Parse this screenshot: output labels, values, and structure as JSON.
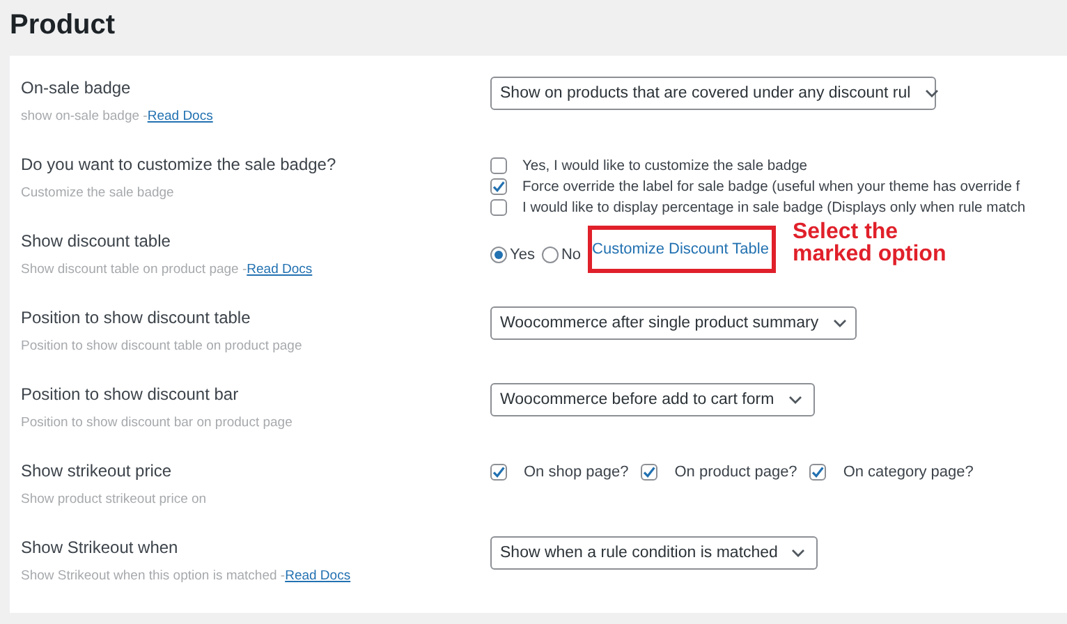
{
  "page": {
    "title": "Product"
  },
  "settings": [
    {
      "label": "On-sale badge",
      "description": "show on-sale badge - ",
      "doc_link": "Read Docs",
      "kind": "select",
      "value": "Show on products that are covered under any discount rul"
    },
    {
      "label": "Do you want to customize the sale badge?",
      "description": "Customize the sale badge",
      "kind": "checklist",
      "options": [
        {
          "label": "Yes, I would like to customize the sale badge",
          "checked": false
        },
        {
          "label": "Force override the label for sale badge (useful when your theme has override f",
          "checked": true
        },
        {
          "label": "I would like to display percentage in sale badge (Displays only when rule match",
          "checked": false
        }
      ]
    },
    {
      "label": "Show discount table",
      "description": "Show discount table on product page - ",
      "doc_link": "Read Docs",
      "kind": "radio",
      "options": [
        {
          "label": "Yes",
          "selected": true
        },
        {
          "label": "No",
          "selected": false
        }
      ],
      "link": "Customize Discount Table",
      "highlighted": true,
      "annotation": "Select the marked option"
    },
    {
      "label": "Position to show discount table",
      "description": "Position to show discount table on product page",
      "kind": "select",
      "value": "Woocommerce after single product summary"
    },
    {
      "label": "Position to show discount bar",
      "description": "Position to show discount bar on product page",
      "kind": "select",
      "value": "Woocommerce before add to cart form"
    },
    {
      "label": "Show strikeout price",
      "description": "Show product strikeout price on",
      "kind": "inline-checks",
      "options": [
        {
          "label": "On shop page?",
          "checked": true
        },
        {
          "label": "On product page?",
          "checked": true
        },
        {
          "label": "On category page?",
          "checked": true
        }
      ]
    },
    {
      "label": "Show Strikeout when",
      "description": "Show Strikeout when this option is matched - ",
      "doc_link": "Read Docs",
      "kind": "select",
      "value": "Show when a rule condition is matched"
    }
  ]
}
